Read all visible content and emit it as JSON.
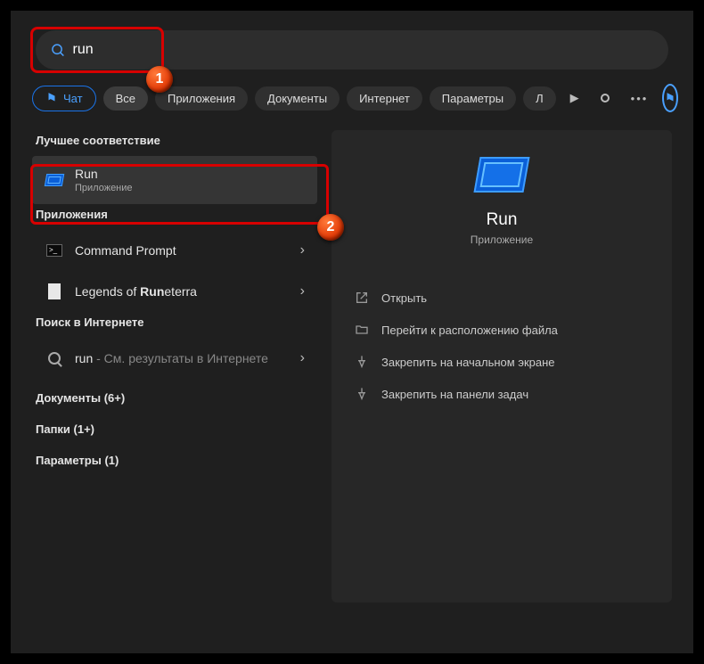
{
  "search": {
    "value": "run"
  },
  "tabs": {
    "chat": "Чат",
    "all": "Все",
    "apps": "Приложения",
    "documents": "Документы",
    "internet": "Интернет",
    "settings": "Параметры",
    "more_cut": "Л"
  },
  "annotations": {
    "badge1": "1",
    "badge2": "2"
  },
  "sections": {
    "best_match": "Лучшее соответствие",
    "apps": "Приложения",
    "web": "Поиск в Интернете",
    "documents": "Документы (6+)",
    "folders": "Папки (1+)",
    "settings": "Параметры (1)"
  },
  "results": {
    "run": {
      "title": "Run",
      "subtitle": "Приложение"
    },
    "cmd": {
      "title": "Command Prompt"
    },
    "lor": {
      "prefix": "Legends of ",
      "bold": "Run",
      "suffix": "eterra"
    },
    "web": {
      "prefix": "run",
      "suffix": " - См. результаты в Интернете"
    }
  },
  "preview": {
    "title": "Run",
    "subtitle": "Приложение",
    "actions": {
      "open": "Открыть",
      "location": "Перейти к расположению файла",
      "pin_start": "Закрепить на начальном экране",
      "pin_taskbar": "Закрепить на панели задач"
    }
  }
}
